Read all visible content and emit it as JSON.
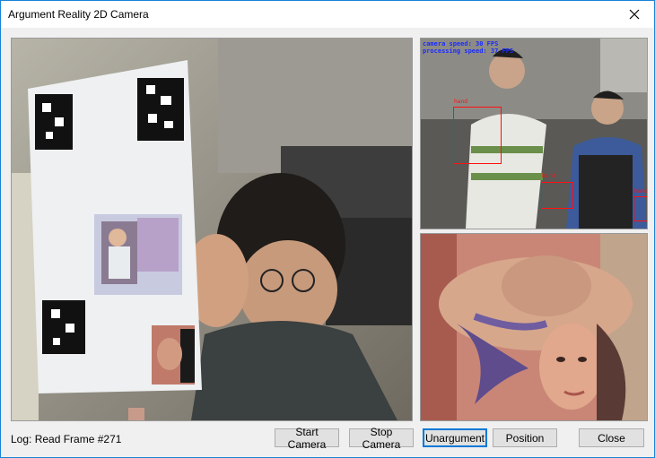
{
  "window": {
    "title": "Argument Reality 2D Camera"
  },
  "camera_overlay": {
    "camera_speed": "camera speed: 30 FPS",
    "processing_speed": "processing speed: 37 FPS",
    "detections": [
      "hand",
      "hand",
      "hand"
    ]
  },
  "log": {
    "text": "Log: Read Frame #271"
  },
  "buttons": {
    "start": "Start Camera",
    "stop": "Stop Camera",
    "unargument": "Unargument",
    "position": "Position",
    "close": "Close"
  }
}
